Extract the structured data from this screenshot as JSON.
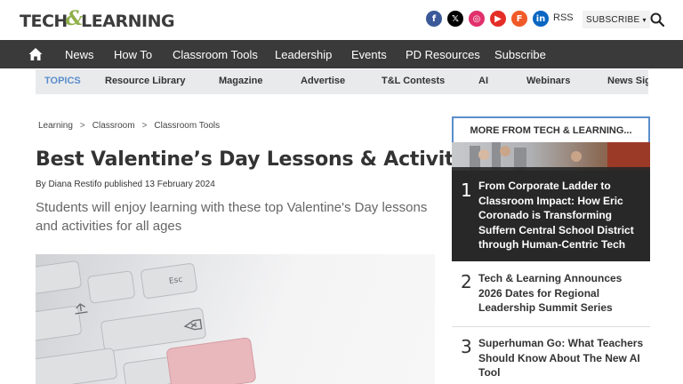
{
  "header": {
    "logo_left": "TECH",
    "logo_amp": "&",
    "logo_right": "LEARNING",
    "social": [
      {
        "name": "facebook",
        "glyph": "f",
        "color": "#3b5998"
      },
      {
        "name": "x",
        "glyph": "𝕏",
        "color": "#000000"
      },
      {
        "name": "instagram",
        "glyph": "◎",
        "color": "#e1306c"
      },
      {
        "name": "youtube",
        "glyph": "▶",
        "color": "#e52d27"
      },
      {
        "name": "flipboard",
        "glyph": "F",
        "color": "#f05a28"
      },
      {
        "name": "linkedin",
        "glyph": "in",
        "color": "#0a66c2"
      }
    ],
    "rss_label": "RSS",
    "subscribe_label": "SUBSCRIBE",
    "subscribe_caret": "▾"
  },
  "nav": {
    "items": [
      "News",
      "How To",
      "Classroom Tools",
      "Leadership",
      "Events",
      "PD Resources",
      "Subscribe"
    ]
  },
  "topics": {
    "label": "TOPICS",
    "items": [
      "Resource Library",
      "Magazine",
      "Advertise",
      "T&L Contests",
      "AI",
      "Webinars",
      "News Sig"
    ]
  },
  "breadcrumb": {
    "items": [
      "Learning",
      "Classroom",
      "Classroom Tools"
    ],
    "separator": ">"
  },
  "article": {
    "title": "Best Valentine’s Day Lessons & Activities",
    "byline": "By Diana Restifo published 13 February 2024",
    "dek": "Students will enjoy learning with these top Valentine's Day lessons and activities for all ages"
  },
  "sidebar": {
    "heading": "MORE FROM TECH & LEARNING...",
    "stories": [
      {
        "rank": "1",
        "title": "From Corporate Ladder to Classroom Impact: How Eric Coronado is Transforming Suffern Central School District through Human-Centric Tech"
      },
      {
        "rank": "2",
        "title": "Tech & Learning Announces 2026 Dates for Regional Leadership Summit Series"
      },
      {
        "rank": "3",
        "title": "Superhuman Go: What Teachers Should Know About The New AI Tool"
      }
    ]
  }
}
